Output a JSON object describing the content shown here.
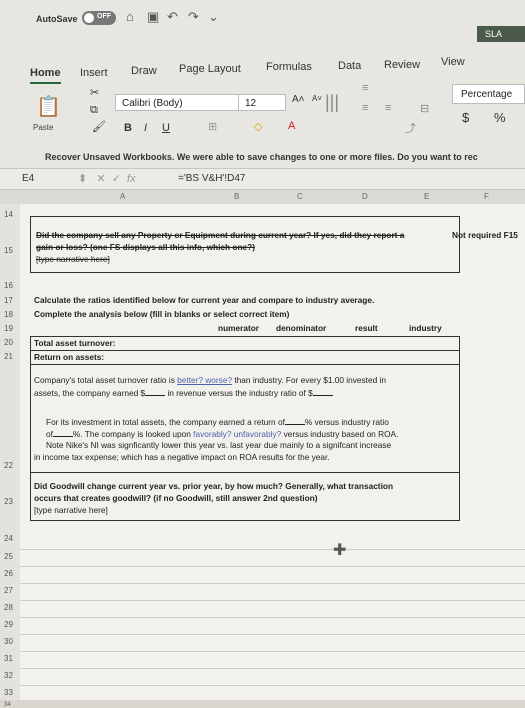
{
  "titlebar": {
    "autosave_label": "AutoSave",
    "autosave_state": "OFF",
    "app_badge": "SLA",
    "icons": [
      "home-icon",
      "save-icon",
      "undo-icon",
      "redo-icon",
      "more-icon"
    ]
  },
  "tabs": [
    "Home",
    "Insert",
    "Draw",
    "Page Layout",
    "Formulas",
    "Data",
    "Review",
    "View"
  ],
  "ribbon": {
    "font_name": "Calibri (Body)",
    "font_size": "12",
    "bold": "B",
    "italic": "I",
    "underline": "U",
    "number_format": "Percentage",
    "currency": "$",
    "percent": "%",
    "paste_label": "Paste"
  },
  "recover_message": "Recover Unsaved Workbooks.  We were able to save changes to one or more files. Do you want to rec",
  "formula_bar": {
    "name_box": "E4",
    "fx": "fx",
    "formula": "='BS V&H'!D47"
  },
  "columns": [
    "A",
    "B",
    "C",
    "D",
    "E",
    "F"
  ],
  "rows": [
    "14",
    "15",
    "16",
    "17",
    "18",
    "19",
    "20",
    "21",
    "22",
    "23",
    "24",
    "25",
    "26",
    "27",
    "28",
    "29",
    "30",
    "31",
    "32",
    "33",
    "34"
  ],
  "cells": {
    "r15_q": "Did the company sell any Property or Equipment during current year?  If yes, did they report a",
    "r15_q2": "gain or loss? (one FS displays all this info, which one?)",
    "r15_q3": "[type narrative here]",
    "r15_note": "Not required F15",
    "r17": "Calculate the ratios identified below for current year and compare to industry average.",
    "r18": "Complete the analysis below (fill in blanks or select correct item)",
    "r19_numerator": "numerator",
    "r19_denominator": "denominator",
    "r19_result": "result",
    "r19_industry": "industry",
    "r20": "Total asset turnover:",
    "r21": "Return on assets:",
    "r22a_1": "Company's total asset turnover ratio is",
    "r22a_better": "better? worse?",
    "r22a_2": "than industry.  For every $1.00 invested in",
    "r22a_3": "assets, the company earned $",
    "r22a_4": "in revenue versus the industry ratio of $",
    "r22b_1": "For its investment in total assets, the company earned a return of",
    "r22b_2": "% versus industry ratio",
    "r22b_3": "of",
    "r22b_4": "%.  The company is looked upon",
    "r22b_fav": "favorably? unfavorably?",
    "r22b_5": "versus industry based on ROA.",
    "r22b_6": "Note Nike's NI was signficantly lower this year vs. last year due mainly to a signifcant increase",
    "r22b_7": "in income tax expense; which has a negative impact on ROA results for the year.",
    "r23_1": "Did Goodwill change current year vs. prior year, by how much? Generally, what transaction",
    "r23_2": "occurs that creates goodwill? (if no Goodwill, still answer 2nd question)",
    "r23_3": "[type narrative here]"
  }
}
